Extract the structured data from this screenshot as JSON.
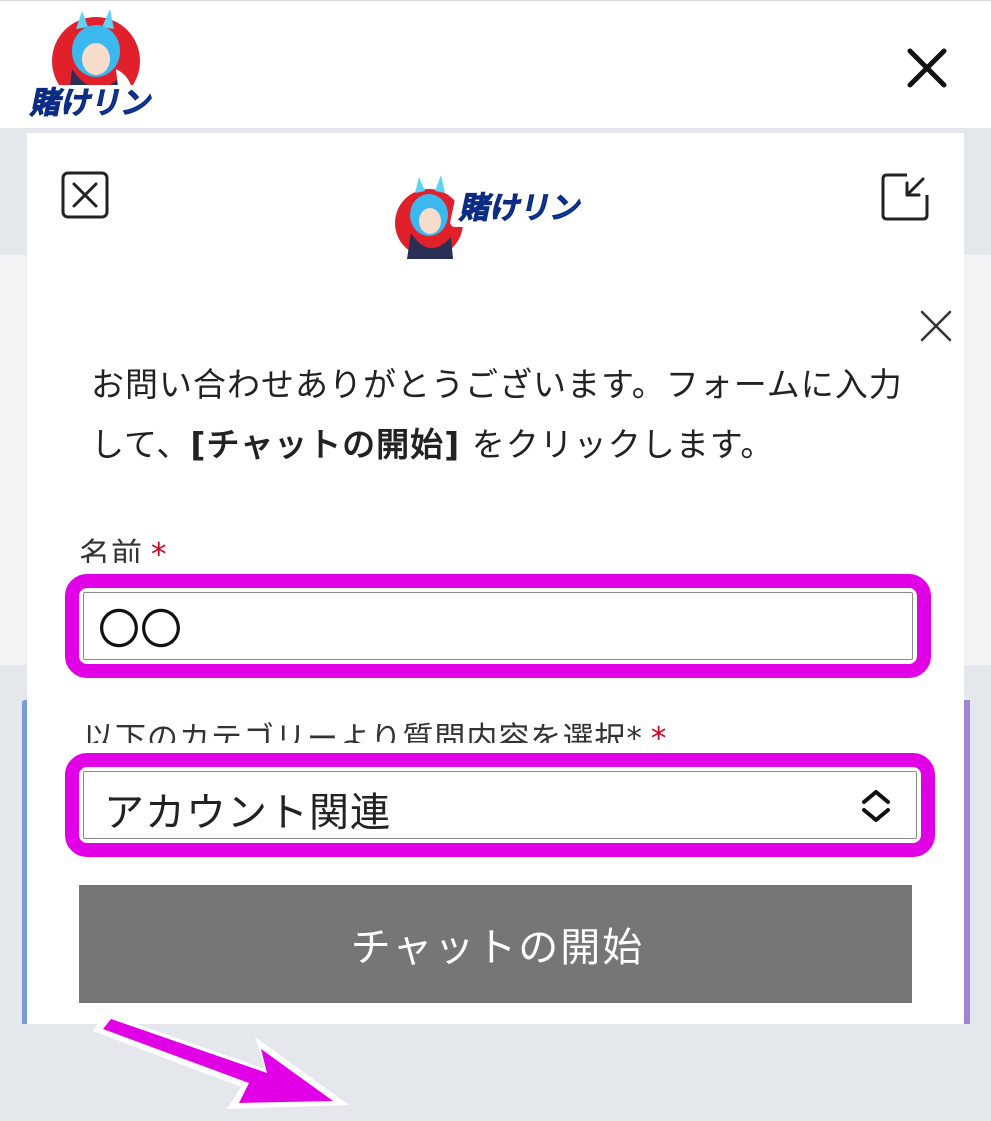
{
  "site_header": {
    "logo_text": "賭けリン"
  },
  "chat": {
    "logo_text": "賭けリン",
    "intro_part1": "お問い合わせありがとうございます。フォームに入力して、",
    "intro_bold": "[チャットの開始]",
    "intro_part2": " をクリックします。",
    "name_label": "名前",
    "required_mark": "*",
    "name_value": "〇〇",
    "category_label": "以下のカテゴリーより質問内容を選択*",
    "category_value": "アカウント関連",
    "start_button_label": "チャットの開始"
  },
  "colors": {
    "highlight": "#e100e6",
    "button": "#767676",
    "required": "#d0021b"
  }
}
